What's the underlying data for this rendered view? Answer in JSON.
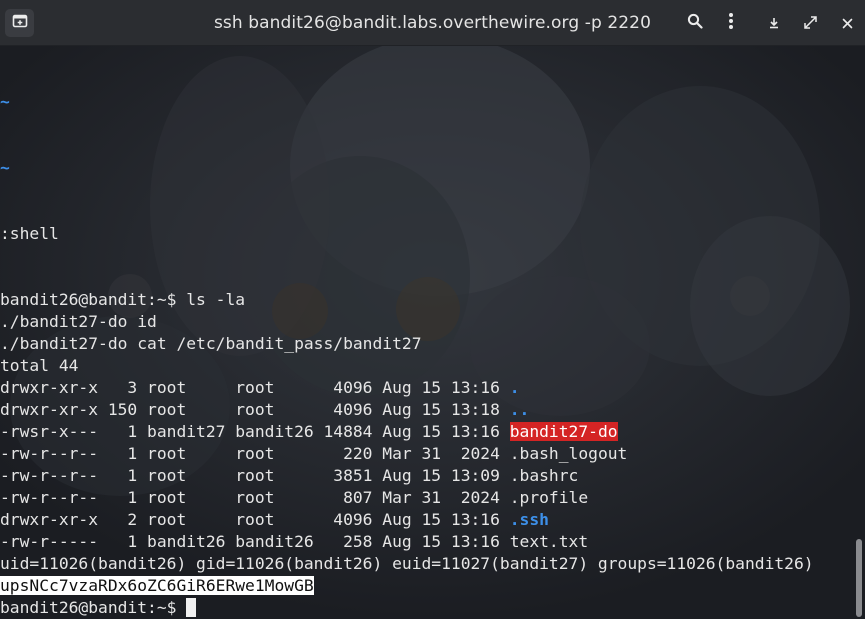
{
  "window": {
    "title": "ssh bandit26@bandit.labs.overthewire.org -p 2220"
  },
  "icons": {
    "new_tab": "new-tab-icon",
    "search": "search-icon",
    "menu": "kebab-menu-icon",
    "download": "download-icon",
    "fullscreen": "fullscreen-icon",
    "close": "close-icon"
  },
  "colors": {
    "tilde": "#3d8fe8",
    "suid_bg": "#d42424",
    "directory": "#3d8fe8"
  },
  "terminal": {
    "tilde1": "~",
    "tilde2": "~",
    "shell_cmd": ":shell",
    "prompt1": "bandit26@bandit:~$ ",
    "cmd1": "ls -la",
    "line_id": "./bandit27-do id",
    "line_cat": "./bandit27-do cat /etc/bandit_pass/bandit27",
    "total": "total 44",
    "rows": [
      {
        "meta": "drwxr-xr-x   3 root     root      4096 Aug 15 13:16 ",
        "name": "."
      },
      {
        "meta": "drwxr-xr-x 150 root     root      4096 Aug 15 13:18 ",
        "name": ".."
      },
      {
        "meta": "-rwsr-x---   1 bandit27 bandit26 14884 Aug 15 13:16 ",
        "name": "bandit27-do"
      },
      {
        "meta": "-rw-r--r--   1 root     root       220 Mar 31  2024 ",
        "name": ".bash_logout"
      },
      {
        "meta": "-rw-r--r--   1 root     root      3851 Aug 15 13:09 ",
        "name": ".bashrc"
      },
      {
        "meta": "-rw-r--r--   1 root     root       807 Mar 31  2024 ",
        "name": ".profile"
      },
      {
        "meta": "drwxr-xr-x   2 root     root      4096 Aug 15 13:16 ",
        "name": ".ssh"
      },
      {
        "meta": "-rw-r-----   1 bandit26 bandit26   258 Aug 15 13:16 ",
        "name": "text.txt"
      }
    ],
    "uid_line": "uid=11026(bandit26) gid=11026(bandit26) euid=11027(bandit27) groups=11026(bandit26)",
    "password": "upsNCc7vzaRDx6oZC6GiR6ERwe1MowGB",
    "prompt2": "bandit26@bandit:~$ "
  }
}
